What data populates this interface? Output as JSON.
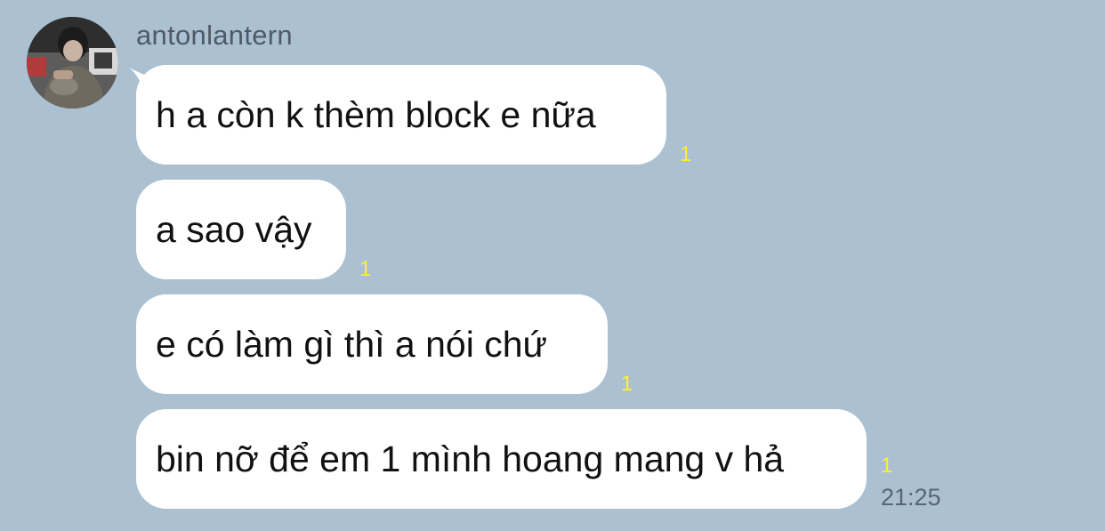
{
  "chat": {
    "sender_name": "antonlantern",
    "messages": [
      {
        "text": "h a còn k thèm block e nữa",
        "read_count": "1"
      },
      {
        "text": "a sao vậy",
        "read_count": "1"
      },
      {
        "text": "e có làm gì thì a nói chứ",
        "read_count": "1"
      },
      {
        "text": "bin nỡ để em 1 mình hoang mang v hả",
        "read_count": "1"
      }
    ],
    "last_time": "21:25"
  },
  "colors": {
    "background": "#abc1d2",
    "bubble": "#ffffff",
    "read_indicator": "#ffee33",
    "timestamp": "#59656f"
  },
  "icons": {
    "avatar": "user-avatar-photo"
  }
}
